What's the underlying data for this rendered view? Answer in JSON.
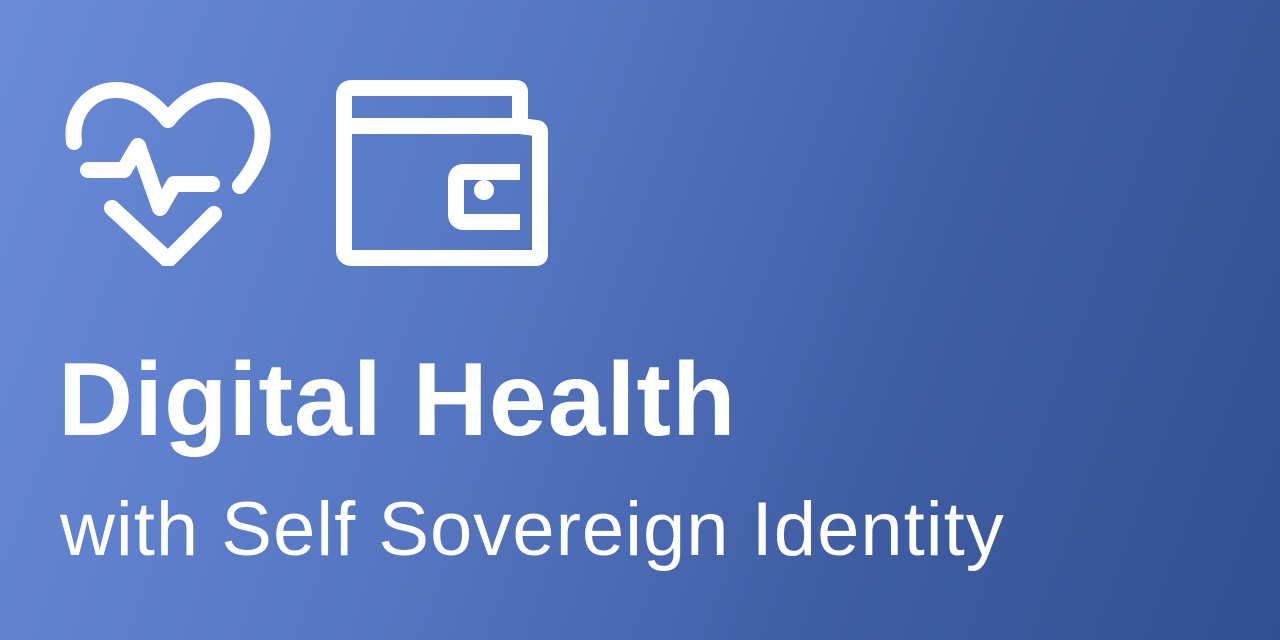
{
  "icons": {
    "first": "heart-pulse-icon",
    "second": "wallet-icon"
  },
  "colors": {
    "gradient_start": "#6a8bd8",
    "gradient_end": "#334f90",
    "foreground": "#ffffff"
  },
  "banner": {
    "title": "Digital Health",
    "subtitle": "with Self Sovereign Identity"
  }
}
